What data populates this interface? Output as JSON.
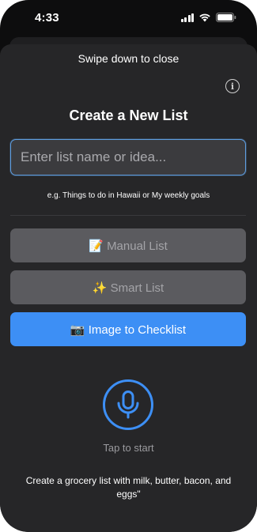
{
  "status_bar": {
    "time": "4:33"
  },
  "sheet": {
    "swipe_hint": "Swipe down to close",
    "info_icon": "info-icon",
    "title": "Create a New List",
    "input": {
      "placeholder": "Enter list name or idea...",
      "value": ""
    },
    "example_hint": "e.g. Things to do in Hawaii or My weekly goals",
    "buttons": {
      "manual": "📝 Manual List",
      "smart": "✨ Smart List",
      "image": "📷 Image to Checklist"
    },
    "mic_icon": "microphone-icon",
    "tap_label": "Tap to start",
    "sample_prompt": "Create a grocery list with milk, butter, bacon, and eggs\""
  },
  "colors": {
    "accent": "#3d8ff5",
    "sheet_bg": "#262628",
    "disabled_button_bg": "#5b5b5f",
    "input_bg": "#3b3b3e",
    "input_border": "#5f9ee0"
  }
}
